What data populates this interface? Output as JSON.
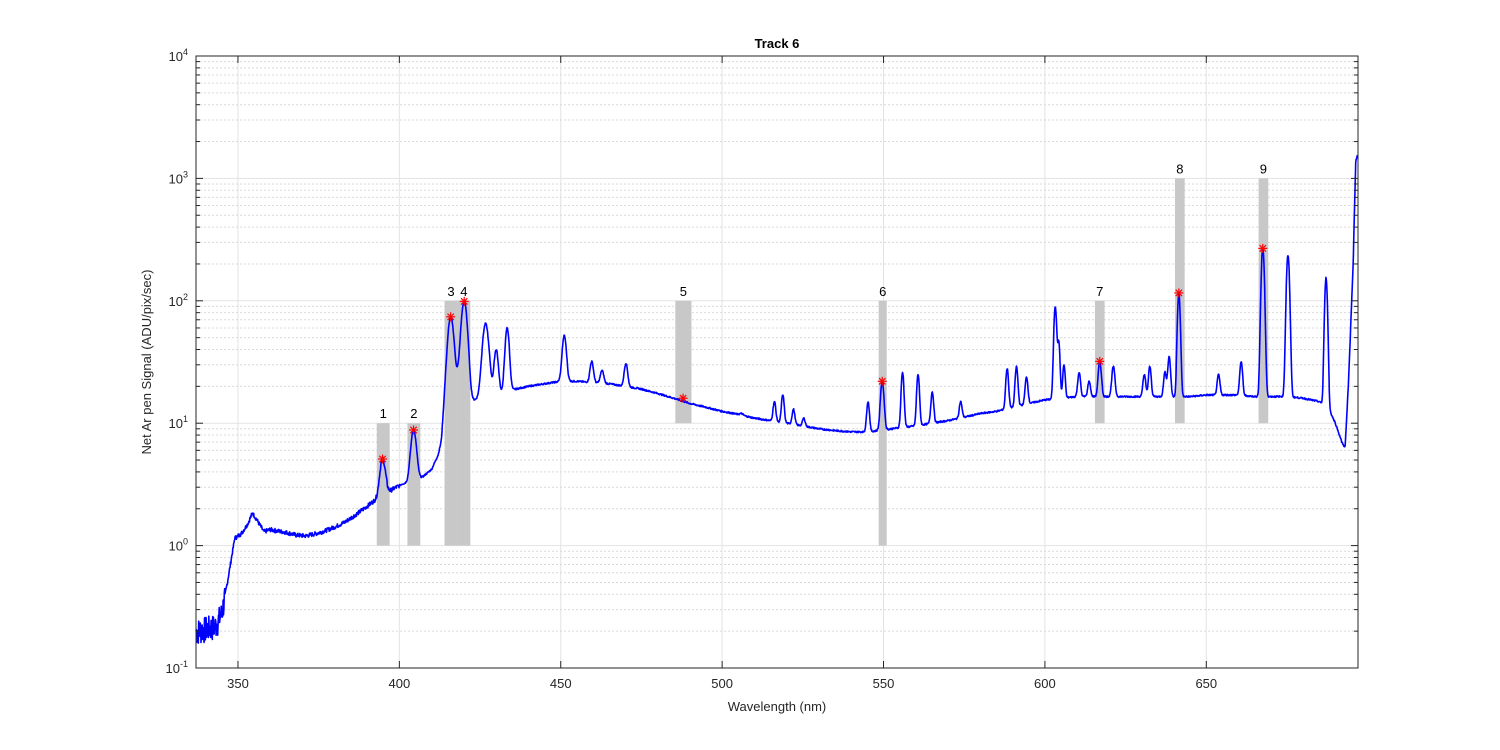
{
  "chart_data": {
    "type": "line",
    "title": "Track 6",
    "xlabel": "Wavelength (nm)",
    "ylabel": "Net Ar pen Signal (ADU/pix/sec)",
    "xlim": [
      337,
      697
    ],
    "ylim": [
      0.1,
      10000
    ],
    "yscale": "log",
    "grid": true,
    "minor_grid": true,
    "x_ticks": [
      350,
      400,
      450,
      500,
      550,
      600,
      650
    ],
    "x_tick_labels": [
      "350",
      "400",
      "450",
      "500",
      "550",
      "600",
      "650"
    ],
    "y_ticks": [
      0.1,
      1,
      10,
      100,
      1000,
      10000
    ],
    "y_tick_labels": [
      {
        "base": "10",
        "exp": "-1"
      },
      {
        "base": "10",
        "exp": "0"
      },
      {
        "base": "10",
        "exp": "1"
      },
      {
        "base": "10",
        "exp": "2"
      },
      {
        "base": "10",
        "exp": "3"
      },
      {
        "base": "10",
        "exp": "4"
      }
    ],
    "colors": {
      "line": "#0000ff",
      "marker": "#ff0000",
      "band": "#c8c8c8",
      "grid": "#e3e3e3"
    },
    "bands": [
      {
        "label": "1",
        "x0": 393.0,
        "x1": 397.0,
        "y0": 1,
        "y1": 10
      },
      {
        "label": "2",
        "x0": 402.5,
        "x1": 406.5,
        "y0": 1,
        "y1": 10
      },
      {
        "label": "3",
        "x0": 414.0,
        "x1": 418.0,
        "y0": 1,
        "y1": 100
      },
      {
        "label": "4",
        "x0": 418.0,
        "x1": 422.0,
        "y0": 1,
        "y1": 100
      },
      {
        "label": "5",
        "x0": 485.5,
        "x1": 490.5,
        "y0": 10,
        "y1": 100
      },
      {
        "label": "6",
        "x0": 548.5,
        "x1": 551.0,
        "y0": 1,
        "y1": 100
      },
      {
        "label": "7",
        "x0": 615.5,
        "x1": 618.5,
        "y0": 10,
        "y1": 100
      },
      {
        "label": "8",
        "x0": 640.3,
        "x1": 643.3,
        "y0": 10,
        "y1": 1000
      },
      {
        "label": "9",
        "x0": 666.2,
        "x1": 669.2,
        "y0": 10,
        "y1": 1000
      }
    ],
    "markers": [
      {
        "x": 394.8,
        "y": 5.1
      },
      {
        "x": 404.4,
        "y": 8.8
      },
      {
        "x": 415.9,
        "y": 74
      },
      {
        "x": 420.1,
        "y": 99
      },
      {
        "x": 487.9,
        "y": 16
      },
      {
        "x": 549.6,
        "y": 22
      },
      {
        "x": 617.0,
        "y": 32
      },
      {
        "x": 641.5,
        "y": 116
      },
      {
        "x": 667.5,
        "y": 268
      }
    ],
    "series": [
      {
        "color": "#0000ff",
        "baseline": [
          [
            337,
            0.2
          ],
          [
            340,
            0.21
          ],
          [
            343,
            0.22
          ],
          [
            345,
            0.28
          ],
          [
            347,
            0.55
          ],
          [
            349,
            1.15
          ],
          [
            351,
            1.25
          ],
          [
            353,
            1.5
          ],
          [
            354.5,
            1.85
          ],
          [
            356,
            1.6
          ],
          [
            358,
            1.3
          ],
          [
            360,
            1.35
          ],
          [
            362,
            1.32
          ],
          [
            365,
            1.28
          ],
          [
            368,
            1.22
          ],
          [
            371,
            1.2
          ],
          [
            374,
            1.25
          ],
          [
            377,
            1.32
          ],
          [
            380,
            1.42
          ],
          [
            383,
            1.55
          ],
          [
            386,
            1.75
          ],
          [
            389,
            2.0
          ],
          [
            392,
            2.3
          ],
          [
            395,
            2.55
          ],
          [
            398,
            2.9
          ],
          [
            401,
            3.2
          ],
          [
            404,
            3.3
          ],
          [
            407,
            3.6
          ],
          [
            410,
            4.2
          ],
          [
            412,
            5.5
          ],
          [
            413,
            7.0
          ],
          [
            414,
            13
          ],
          [
            416,
            18
          ],
          [
            418,
            20
          ],
          [
            420,
            16
          ],
          [
            422,
            15
          ],
          [
            425,
            16
          ],
          [
            428,
            18
          ],
          [
            432,
            18
          ],
          [
            436,
            19
          ],
          [
            440,
            20
          ],
          [
            445,
            21
          ],
          [
            450,
            22
          ],
          [
            455,
            22
          ],
          [
            460,
            21.5
          ],
          [
            465,
            21
          ],
          [
            470,
            20
          ],
          [
            475,
            19
          ],
          [
            480,
            17.5
          ],
          [
            485,
            16
          ],
          [
            490,
            14.5
          ],
          [
            495,
            13.5
          ],
          [
            500,
            12.5
          ],
          [
            505,
            11.8
          ],
          [
            510,
            11.0
          ],
          [
            515,
            10.5
          ],
          [
            520,
            10.0
          ],
          [
            525,
            9.5
          ],
          [
            530,
            9.0
          ],
          [
            535,
            8.7
          ],
          [
            540,
            8.5
          ],
          [
            545,
            8.5
          ],
          [
            550,
            8.8
          ],
          [
            555,
            9.2
          ],
          [
            560,
            9.5
          ],
          [
            565,
            10.0
          ],
          [
            570,
            10.5
          ],
          [
            575,
            11.2
          ],
          [
            580,
            12.0
          ],
          [
            585,
            12.5
          ],
          [
            590,
            13.5
          ],
          [
            595,
            14.5
          ],
          [
            600,
            15.5
          ],
          [
            605,
            16.0
          ],
          [
            610,
            16.5
          ],
          [
            615,
            16.5
          ],
          [
            620,
            16.5
          ],
          [
            625,
            16.5
          ],
          [
            630,
            16.5
          ],
          [
            635,
            16.5
          ],
          [
            640,
            16.5
          ],
          [
            645,
            16.5
          ],
          [
            650,
            17.0
          ],
          [
            655,
            17.0
          ],
          [
            660,
            17.0
          ],
          [
            665,
            16.5
          ],
          [
            670,
            16.5
          ],
          [
            675,
            16.5
          ],
          [
            680,
            16.0
          ],
          [
            685,
            15.0
          ],
          [
            688,
            13.0
          ],
          [
            690,
            10.0
          ],
          [
            692,
            7.0
          ],
          [
            693,
            6.3
          ],
          [
            694,
            20
          ],
          [
            695.5,
            200
          ],
          [
            696.3,
            1400
          ],
          [
            697,
            1600
          ]
        ],
        "peaks": [
          [
            394.8,
            5.1,
            0.8
          ],
          [
            404.4,
            8.8,
            0.8
          ],
          [
            415.9,
            74,
            0.9
          ],
          [
            420.1,
            99,
            0.9
          ],
          [
            426.7,
            65,
            0.9
          ],
          [
            430.0,
            40,
            0.6
          ],
          [
            433.4,
            60,
            0.6
          ],
          [
            451.1,
            52,
            0.6
          ],
          [
            459.6,
            32,
            0.5
          ],
          [
            462.8,
            27,
            0.5
          ],
          [
            470.2,
            31,
            0.5
          ],
          [
            506.0,
            12,
            0.5
          ],
          [
            516.2,
            15,
            0.4
          ],
          [
            518.8,
            17,
            0.4
          ],
          [
            522.1,
            13,
            0.4
          ],
          [
            525.3,
            11,
            0.4
          ],
          [
            545.2,
            15,
            0.4
          ],
          [
            549.6,
            22,
            0.5
          ],
          [
            555.9,
            26,
            0.4
          ],
          [
            560.7,
            25,
            0.4
          ],
          [
            565.1,
            18,
            0.4
          ],
          [
            573.9,
            15,
            0.4
          ],
          [
            588.3,
            28,
            0.4
          ],
          [
            591.2,
            29,
            0.4
          ],
          [
            594.3,
            24,
            0.4
          ],
          [
            603.2,
            90,
            0.4
          ],
          [
            604.3,
            45,
            0.35
          ],
          [
            605.9,
            30,
            0.35
          ],
          [
            610.6,
            26,
            0.4
          ],
          [
            613.7,
            22,
            0.4
          ],
          [
            617.0,
            32,
            0.45
          ],
          [
            621.2,
            29,
            0.45
          ],
          [
            630.8,
            25,
            0.4
          ],
          [
            632.5,
            29,
            0.4
          ],
          [
            637.2,
            26,
            0.4
          ],
          [
            638.5,
            35,
            0.4
          ],
          [
            641.5,
            116,
            0.4
          ],
          [
            653.8,
            25,
            0.4
          ],
          [
            660.8,
            32,
            0.4
          ],
          [
            667.5,
            268,
            0.45
          ],
          [
            675.3,
            235,
            0.45
          ],
          [
            687.1,
            155,
            0.4
          ]
        ]
      }
    ]
  }
}
